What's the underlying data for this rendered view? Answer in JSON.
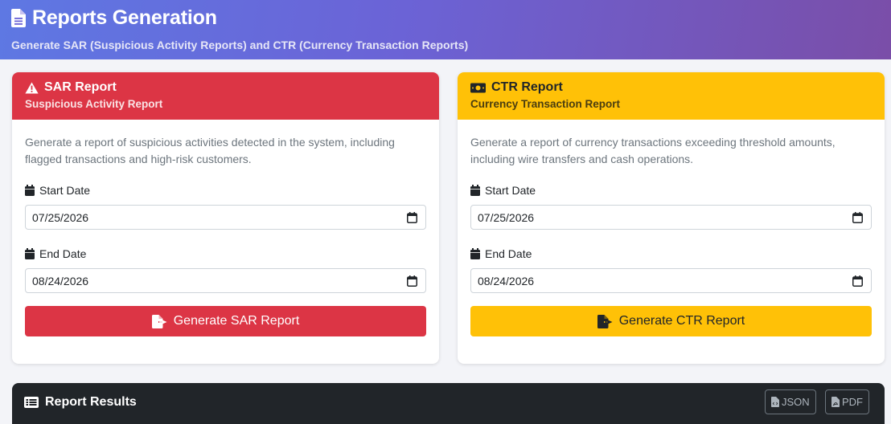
{
  "header": {
    "title": "Reports Generation",
    "subtitle": "Generate SAR (Suspicious Activity Reports) and CTR (Currency Transaction Reports)",
    "icon": "file-text-icon"
  },
  "sar": {
    "title": "SAR Report",
    "subtitle": "Suspicious Activity Report",
    "description": "Generate a report of suspicious activities detected in the system, including flagged transactions and high-risk customers.",
    "start_label": "Start Date",
    "start_value": "07/25/2026",
    "end_label": "End Date",
    "end_value": "08/24/2026",
    "button_label": "Generate SAR Report",
    "color": "#dc3545",
    "icon": "warning-triangle-icon"
  },
  "ctr": {
    "title": "CTR Report",
    "subtitle": "Currency Transaction Report",
    "description": "Generate a report of currency transactions exceeding threshold amounts, including wire transfers and cash operations.",
    "start_label": "Start Date",
    "start_value": "07/25/2026",
    "end_label": "End Date",
    "end_value": "08/24/2026",
    "button_label": "Generate CTR Report",
    "color": "#ffc107",
    "icon": "money-bill-icon"
  },
  "results": {
    "title": "Report Results",
    "json_label": "JSON",
    "pdf_label": "PDF",
    "background": "#212529"
  }
}
